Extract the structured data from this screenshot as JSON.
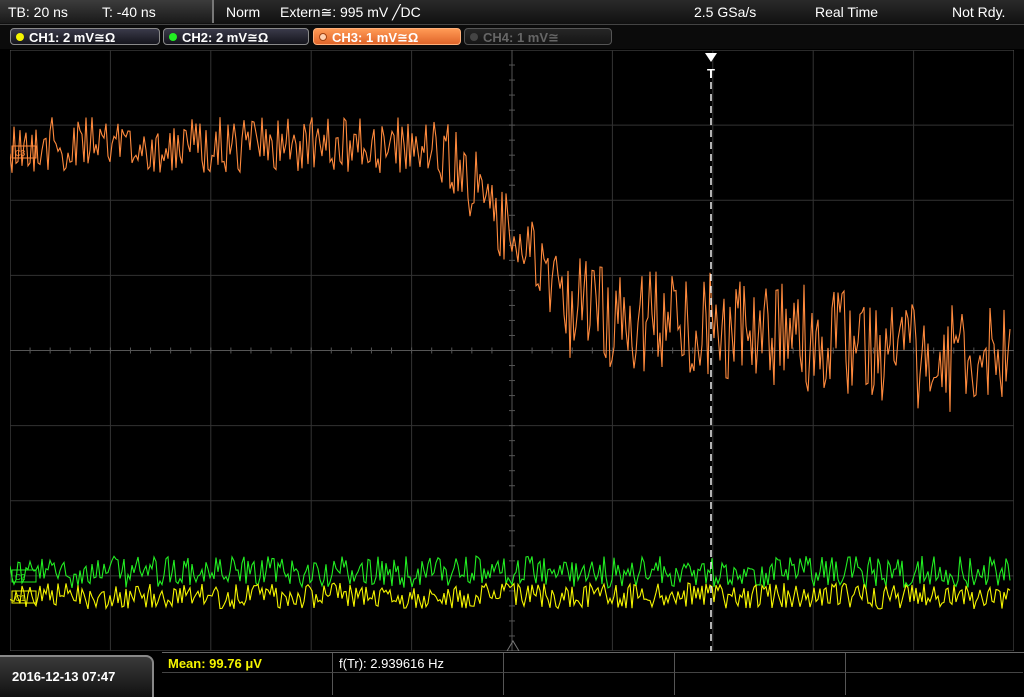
{
  "header": {
    "timebase": "TB: 20 ns",
    "trigger_time": "T: -40 ns",
    "mode": "Norm",
    "trigger_source": "Extern≅: 995 mV ╱DC",
    "sample_rate": "2.5 GSa/s",
    "acq_mode": "Real Time",
    "status": "Not Rdy."
  },
  "channels": [
    {
      "label": "CH1: 2 mV≅Ω",
      "color": "#f5f500",
      "active": false,
      "enabled": true
    },
    {
      "label": "CH2: 2 mV≅Ω",
      "color": "#22ee22",
      "active": false,
      "enabled": true
    },
    {
      "label": "CH3: 1 mV≅Ω",
      "color": "#ff8a3d",
      "active": true,
      "enabled": true
    },
    {
      "label": "CH4: 1 mV≅",
      "color": "#666666",
      "active": false,
      "enabled": false
    }
  ],
  "markers": {
    "trigger_label": "T",
    "ch3_label": "C3",
    "ch2_label": "C2",
    "ch1_label": "C1"
  },
  "footer": {
    "datetime": "2016-12-13 07:47",
    "mean_label": "Mean: 99.76 μV",
    "freq_label": "f(Tr): 2.939616 Hz"
  },
  "colors": {
    "ch1": "#f5f500",
    "ch2": "#22ee22",
    "ch3": "#ff8a3d",
    "grid": "#3a3a3a",
    "mean_text": "#f5f500"
  }
}
